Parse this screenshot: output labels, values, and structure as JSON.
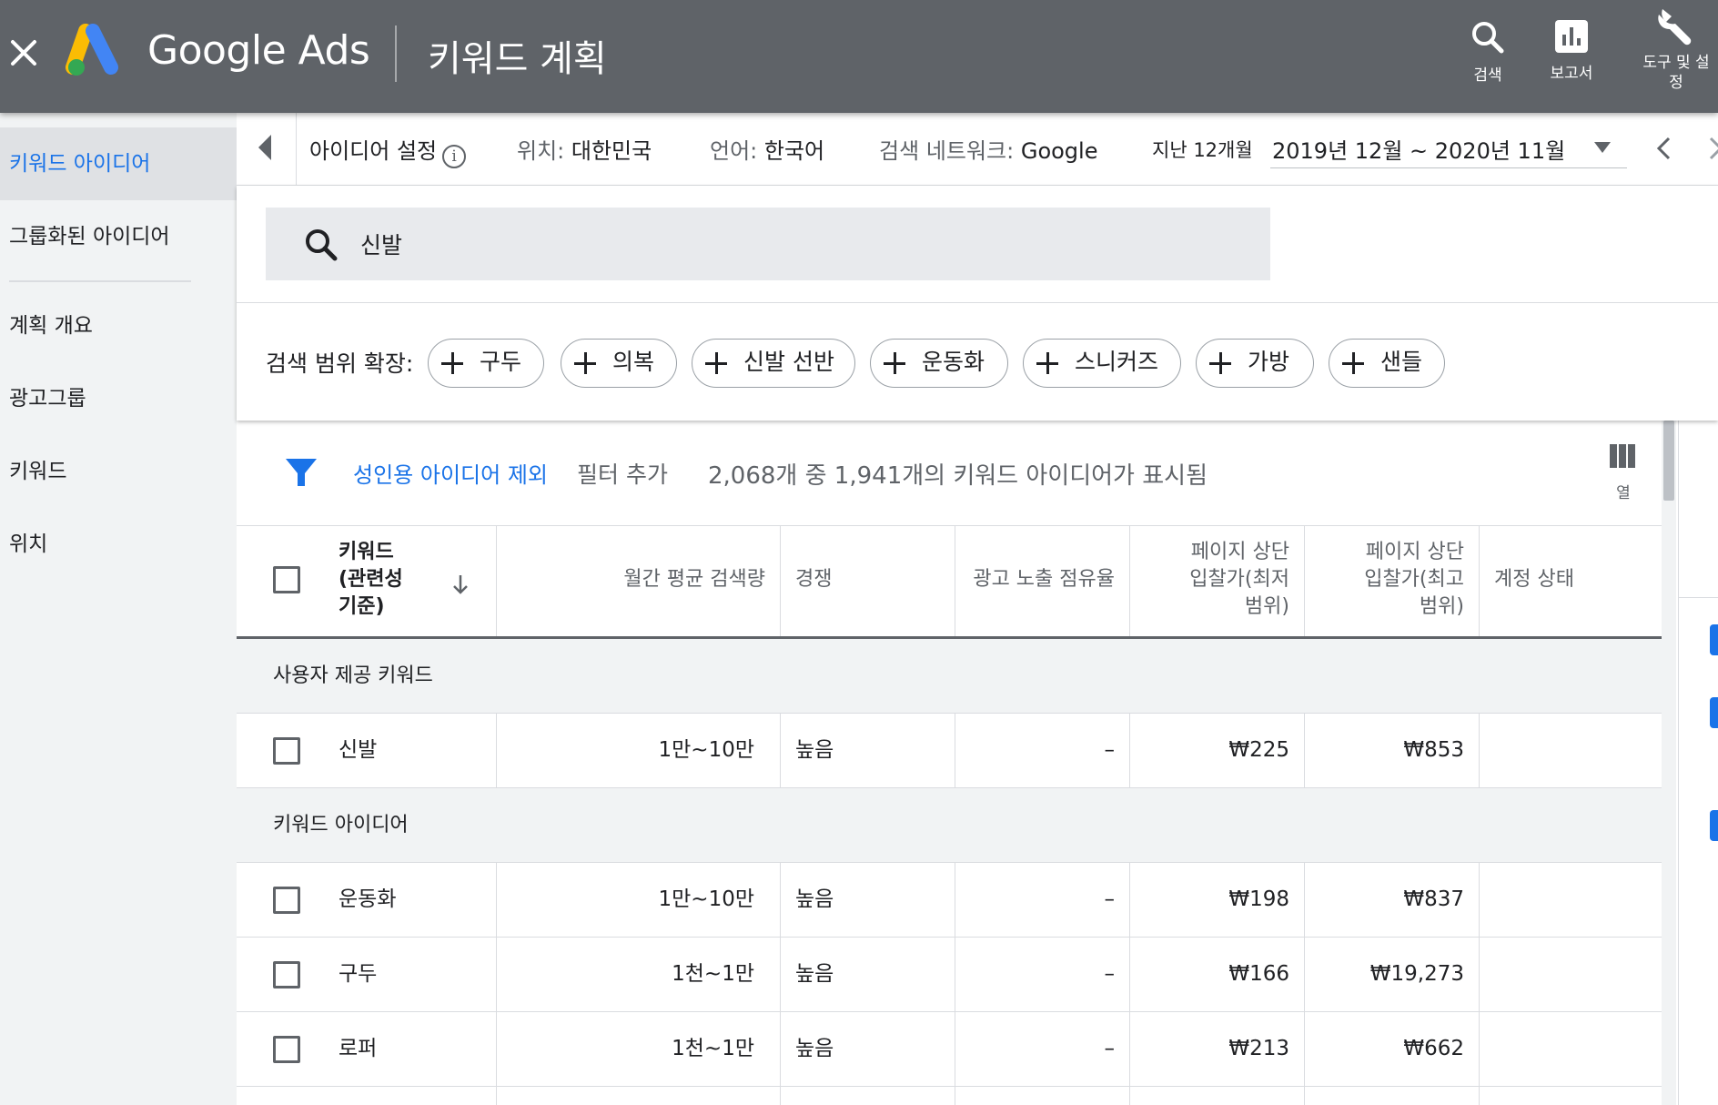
{
  "topbar": {
    "brand": "Google Ads",
    "page_title": "키워드 계획",
    "search_label": "검색",
    "reports_label": "보고서",
    "tools_label_1": "도구 및 설",
    "tools_label_2": "정"
  },
  "sidebar": {
    "items": [
      {
        "label": "키워드 아이디어",
        "active": true
      },
      {
        "label": "그룹화된 아이디어"
      },
      {
        "label": "계획 개요"
      },
      {
        "label": "광고그룹"
      },
      {
        "label": "키워드"
      },
      {
        "label": "위치"
      }
    ]
  },
  "settings": {
    "idea_settings": "아이디어 설정",
    "location_label": "위치:",
    "location_value": "대한민국",
    "language_label": "언어:",
    "language_value": "한국어",
    "network_label": "검색 네트워크:",
    "network_value": "Google",
    "period_label": "지난 12개월",
    "period_value": "2019년 12월 ~ 2020년 11월"
  },
  "search": {
    "value": "신발",
    "broaden_label": "검색 범위 확장:",
    "chips": [
      "구두",
      "의복",
      "신발 선반",
      "운동화",
      "스니커즈",
      "가방",
      "샌들"
    ]
  },
  "filterbar": {
    "exclude_adult": "성인용 아이디어 제외",
    "add_filter": "필터 추가",
    "count_text": "2,068개 중 1,941개의 키워드 아이디어가 표시됨",
    "columns_label": "열"
  },
  "table": {
    "headers": {
      "keyword_1": "키워드",
      "keyword_2": "(관련성",
      "keyword_3": "기준)",
      "monthly": "월간 평균 검색량",
      "competition": "경쟁",
      "impression_share": "광고 노출 점유율",
      "low_bid_1": "페이지 상단",
      "low_bid_2": "입찰가(최저",
      "low_bid_3": "범위)",
      "high_bid_1": "페이지 상단",
      "high_bid_2": "입찰가(최고",
      "high_bid_3": "범위)",
      "account_status": "계정 상태"
    },
    "group_provided": "사용자 제공 키워드",
    "group_ideas": "키워드 아이디어",
    "provided": [
      {
        "keyword": "신발",
        "monthly": "1만~10만",
        "competition": "높음",
        "share": "–",
        "low": "₩225",
        "high": "₩853"
      }
    ],
    "ideas": [
      {
        "keyword": "운동화",
        "monthly": "1만~10만",
        "competition": "높음",
        "share": "–",
        "low": "₩198",
        "high": "₩837"
      },
      {
        "keyword": "구두",
        "monthly": "1천~1만",
        "competition": "높음",
        "share": "–",
        "low": "₩166",
        "high": "₩19,273"
      },
      {
        "keyword": "로퍼",
        "monthly": "1천~1만",
        "competition": "높음",
        "share": "–",
        "low": "₩213",
        "high": "₩662"
      }
    ]
  },
  "colors": {
    "topbar": "#5f6368",
    "accent": "#1a73e8",
    "sidebar": "#f1f3f4",
    "logo_blue": "#4285f4",
    "logo_yellow": "#fbbc04",
    "logo_green": "#34a853"
  }
}
